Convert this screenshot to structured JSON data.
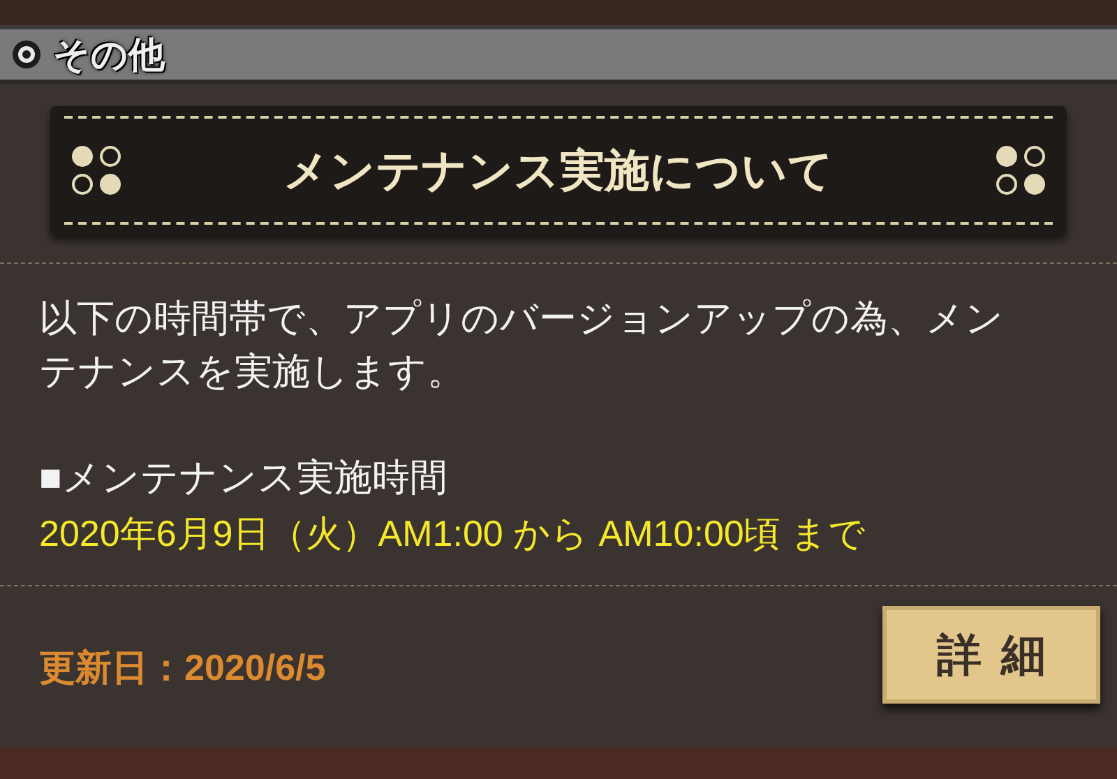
{
  "header": {
    "title": "その他"
  },
  "banner": {
    "title": "メンテナンス実施について"
  },
  "body": {
    "paragraph": "以下の時間帯で、アプリのバージョンアップの為、メンテナンスを実施します。",
    "section_heading": "■メンテナンス実施時間",
    "schedule": "2020年6月9日（火）AM1:00 から AM10:00頃 まで"
  },
  "footer": {
    "updated": "更新日：2020/6/5",
    "button": "詳細"
  }
}
